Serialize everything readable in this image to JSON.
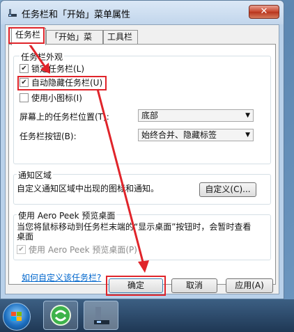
{
  "window": {
    "title": "任务栏和「开始」菜单属性",
    "close": "✕"
  },
  "tabs": [
    {
      "label": "任务栏"
    },
    {
      "label": "「开始」菜单"
    },
    {
      "label": "工具栏"
    }
  ],
  "appearance": {
    "legend": "任务栏外观",
    "lock": {
      "label": "锁定任务栏(L)",
      "checked": true
    },
    "autohide": {
      "label": "自动隐藏任务栏(U)",
      "checked": true
    },
    "small_icons": {
      "label": "使用小图标(I)",
      "checked": false
    },
    "position_label": "屏幕上的任务栏位置(T):",
    "position_value": "底部",
    "buttons_label": "任务栏按钮(B):",
    "buttons_value": "始终合并、隐藏标签"
  },
  "notify": {
    "legend": "通知区域",
    "text": "自定义通知区域中出现的图标和通知。",
    "customize_button": "自定义(C)..."
  },
  "aero": {
    "legend": "使用 Aero Peek 预览桌面",
    "text": "当您将鼠标移动到任务栏末端的“显示桌面”按钮时，会暂时查看桌面",
    "checkbox_label": "使用 Aero Peek 预览桌面(P)"
  },
  "help_link": "如何自定义该任务栏?",
  "buttons": {
    "ok": "确定",
    "cancel": "取消",
    "apply": "应用(A)"
  },
  "annotation_color": "#e0242a"
}
